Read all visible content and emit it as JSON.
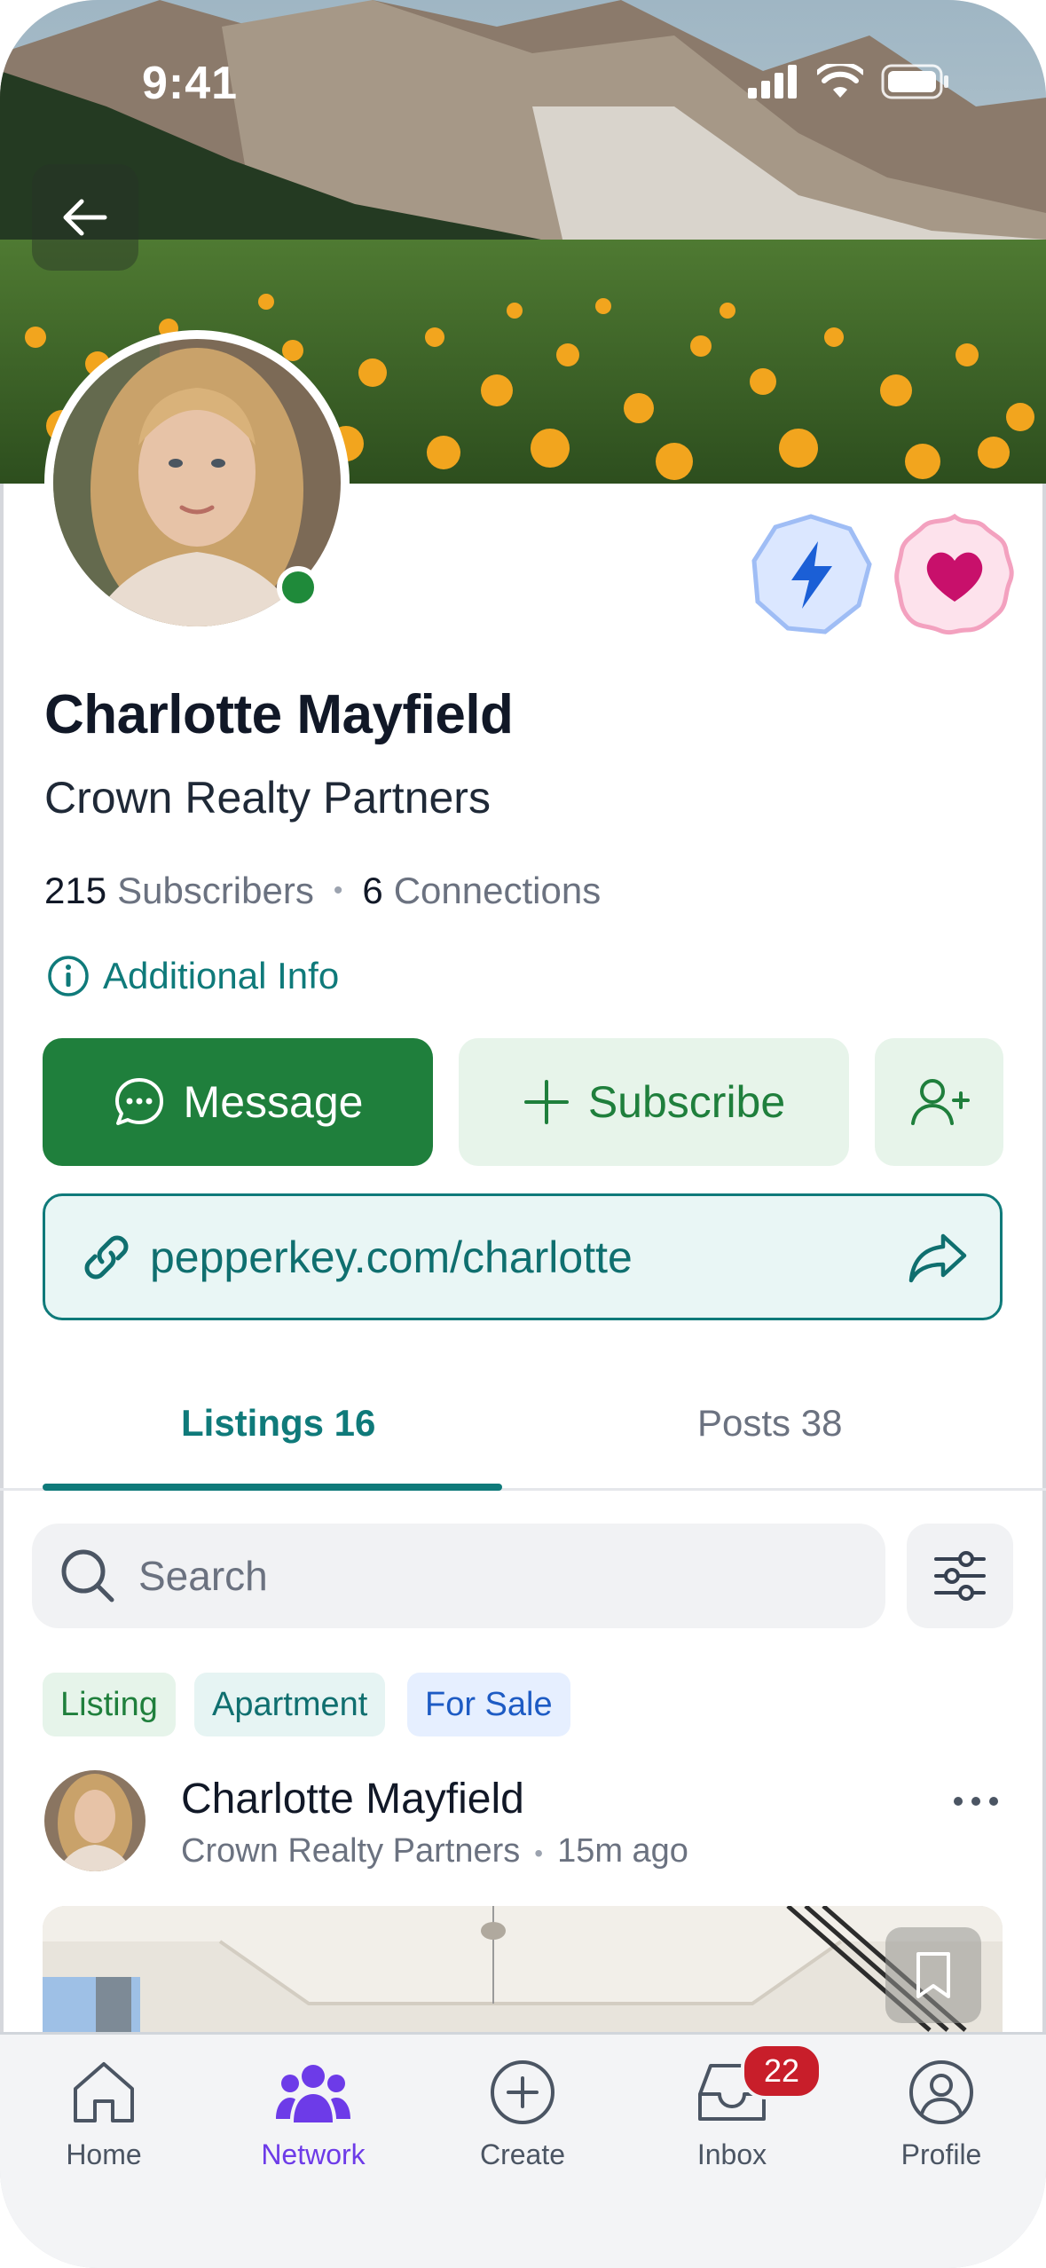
{
  "status_bar": {
    "time": "9:41"
  },
  "profile": {
    "name": "Charlotte Mayfield",
    "company": "Crown Realty Partners",
    "subscribers_count": "215",
    "subscribers_label": "Subscribers",
    "connections_count": "6",
    "connections_label": "Connections",
    "additional_info": "Additional Info",
    "online": true
  },
  "actions": {
    "message_label": "Message",
    "subscribe_label": "Subscribe",
    "profile_link": "pepperkey.com/charlotte"
  },
  "tabs": [
    {
      "label": "Listings 16",
      "active": true
    },
    {
      "label": "Posts 38",
      "active": false
    }
  ],
  "search": {
    "placeholder": "Search"
  },
  "filters": [
    {
      "label": "Listing",
      "color": "#1f7f3c"
    },
    {
      "label": "Apartment",
      "color": "#0f6f6f"
    },
    {
      "label": "For Sale",
      "color": "#1d5bc4"
    }
  ],
  "post": {
    "author": "Charlotte Mayfield",
    "company": "Crown Realty Partners",
    "time": "15m ago"
  },
  "bottom_nav": [
    {
      "label": "Home",
      "icon": "home-icon",
      "active": false
    },
    {
      "label": "Network",
      "icon": "people-icon",
      "active": true
    },
    {
      "label": "Create",
      "icon": "plus-circle-icon",
      "active": false
    },
    {
      "label": "Inbox",
      "icon": "inbox-icon",
      "active": false,
      "badge": "22"
    },
    {
      "label": "Profile",
      "icon": "user-circle-icon",
      "active": false
    }
  ],
  "colors": {
    "primary_green": "#1f7f3c",
    "teal": "#0f7a7a",
    "nav_active": "#6d3be8",
    "badge_red": "#c81e2a"
  }
}
